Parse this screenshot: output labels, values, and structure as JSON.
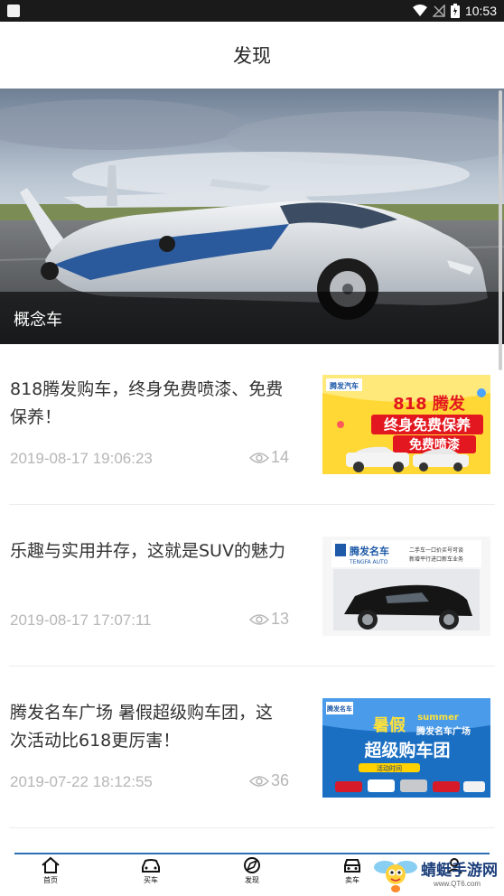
{
  "status_bar": {
    "time": "10:53"
  },
  "header": {
    "title": "发现"
  },
  "banner": {
    "caption": "概念车"
  },
  "articles": [
    {
      "title": "818腾发购车，终身免费喷漆、免费保养！",
      "date": "2019-08-17 19:06:23",
      "views": "14",
      "thumb": {
        "logo": "腾发汽车",
        "line1": "818 腾发",
        "line2": "终身免费保养",
        "line3": "免费喷漆"
      }
    },
    {
      "title": "乐趣与实用并存，这就是SUV的魅力",
      "date": "2019-08-17 17:07:11",
      "views": "13",
      "thumb": {
        "logo": "腾发名车",
        "logo_en": "TENGFA AUTO",
        "line1": "二手车一口价买号可谈",
        "line2": "新增平行进口新车业务"
      }
    },
    {
      "title": "腾发名车广场 暑假超级购车团，这次活动比618更厉害！",
      "date": "2019-07-22 18:12:55",
      "views": "36",
      "thumb": {
        "logo": "腾发名车",
        "line1": "暑假",
        "line1_en": "summer",
        "line2": "腾发名车广场",
        "line3": "超级购车团",
        "line4": "活动时间"
      }
    }
  ],
  "tabbar": {
    "tabs": [
      {
        "label": "首页"
      },
      {
        "label": "买车"
      },
      {
        "label": "发现"
      },
      {
        "label": "卖车"
      }
    ]
  },
  "watermark": {
    "text": "蜻蜓手游网",
    "url": "www.QT6.com"
  },
  "colors": {
    "accent": "#2d6fb3",
    "date_gray": "#b6b6b6",
    "title_text": "#333333"
  }
}
